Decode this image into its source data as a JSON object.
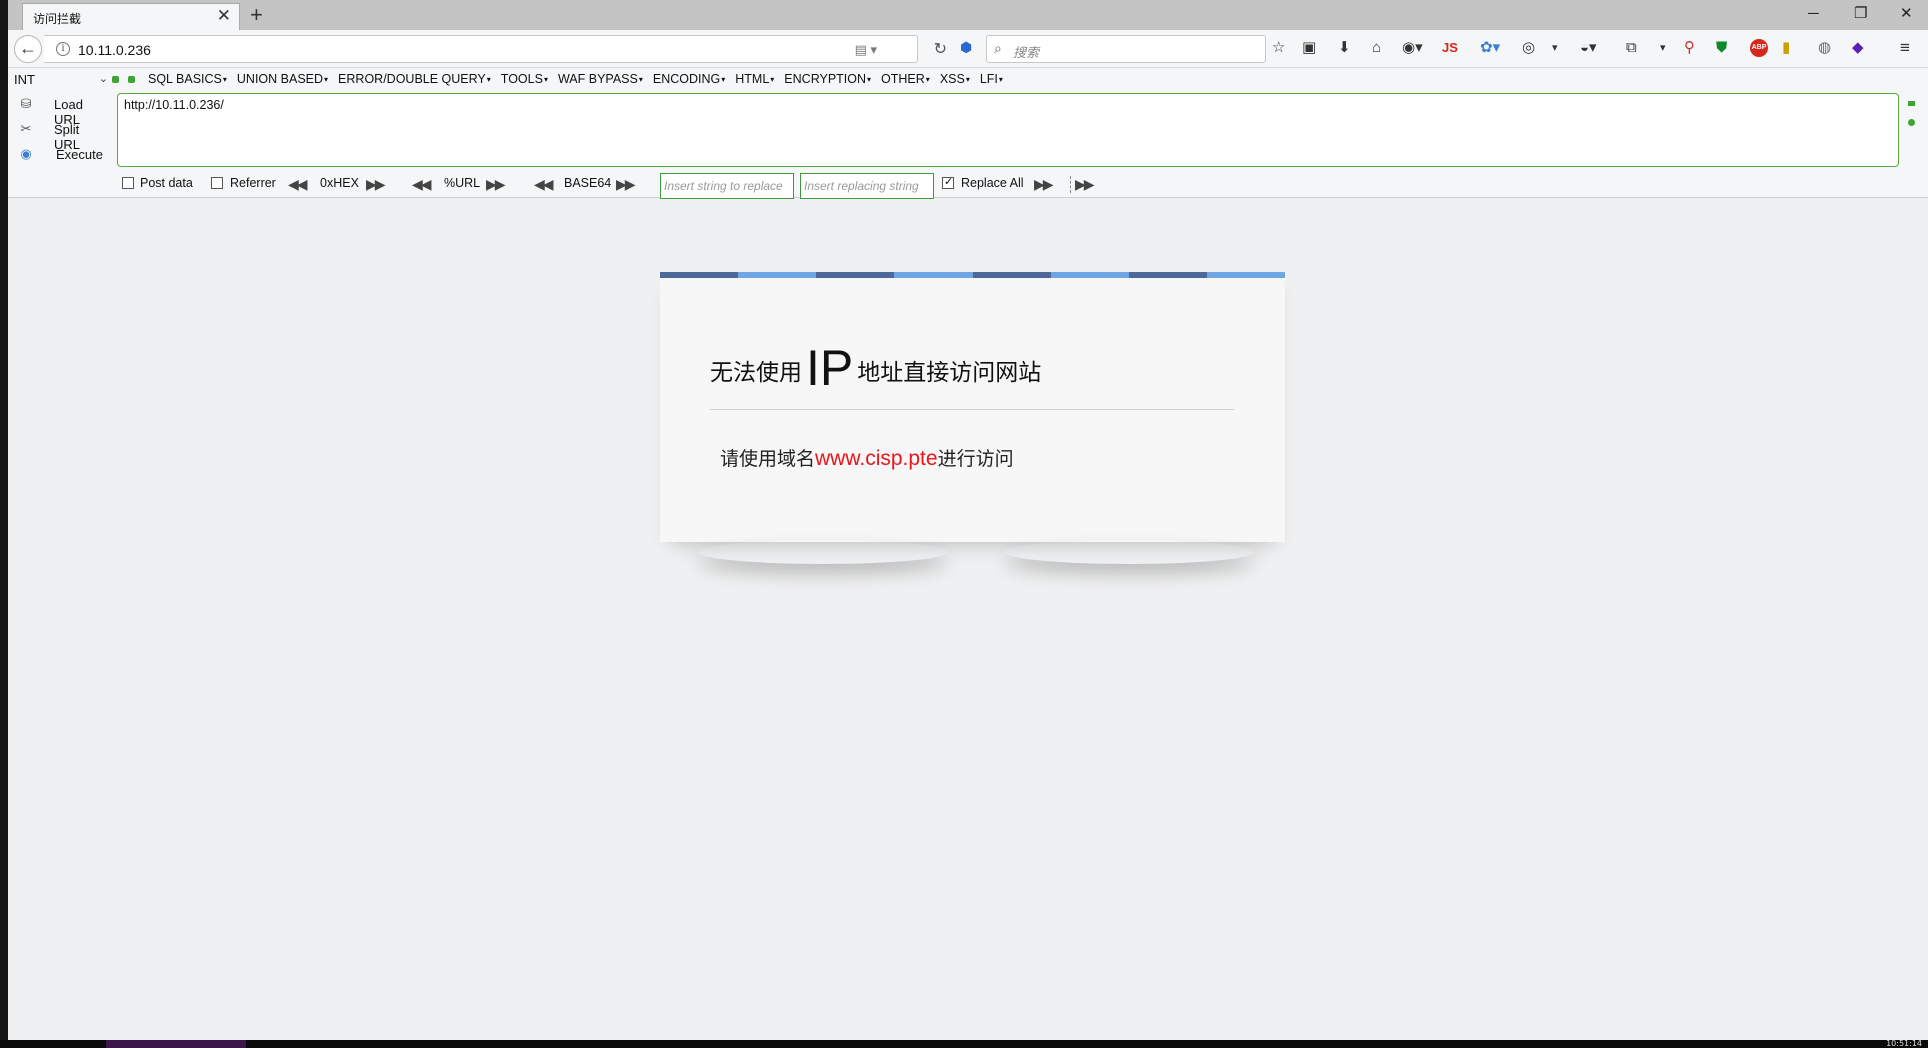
{
  "tab": {
    "title": "访问拦截",
    "close": "✕",
    "new_tab": "+"
  },
  "window": {
    "minimize": "─",
    "restore": "❐",
    "close": "✕"
  },
  "nav": {
    "url": "10.11.0.236",
    "search_placeholder": "搜索"
  },
  "toolbar": {
    "js_label": "JS",
    "abp_label": "ABP"
  },
  "hackbar": {
    "select_value": "INT",
    "menus": [
      "SQL BASICS",
      "UNION BASED",
      "ERROR/DOUBLE QUERY",
      "TOOLS",
      "WAF BYPASS",
      "ENCODING",
      "HTML",
      "ENCRYPTION",
      "OTHER",
      "XSS",
      "LFI"
    ],
    "load_url": "Load URL",
    "split_url": "Split URL",
    "execute": "Execute",
    "url_value": "http://10.11.0.236/",
    "post_data": "Post data",
    "referrer": "Referrer",
    "hex": "0xHEX",
    "urlenc": "%URL",
    "base64": "BASE64",
    "replace_placeholder": "Insert string to replace",
    "replacing_placeholder": "Insert replacing string",
    "replace_all": "Replace All",
    "replace_all_checked": true
  },
  "page": {
    "heading_pre": "无法使用",
    "heading_ip": "IP",
    "heading_post": "地址直接访问网站",
    "msg_pre": "请使用域名",
    "msg_domain": "www.cisp.pte",
    "msg_post": "进行访问",
    "stripe_colors": [
      "#4f689c",
      "#6da6e2"
    ]
  },
  "taskbar": {
    "clock": "10:51:14"
  }
}
